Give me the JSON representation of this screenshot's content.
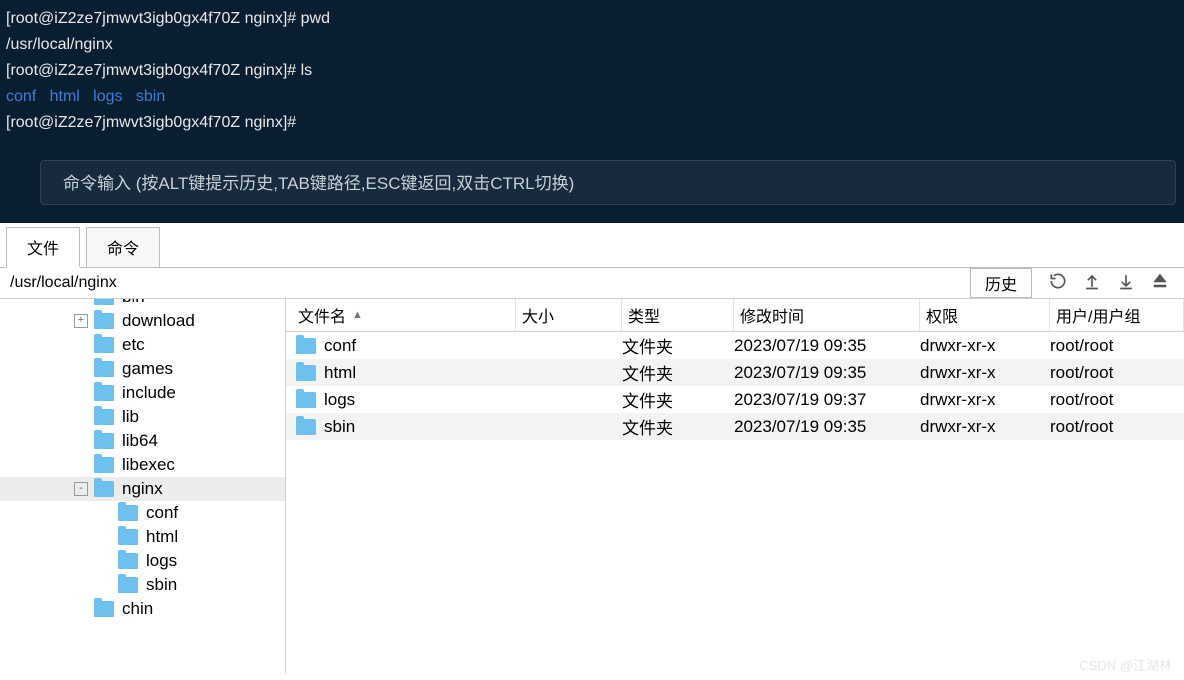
{
  "terminal": {
    "lines": [
      {
        "prompt": "[root@iZ2ze7jmwvt3igb0gx4f70Z nginx]# ",
        "cmd": "pwd"
      },
      {
        "plain": "/usr/local/nginx"
      },
      {
        "prompt": "[root@iZ2ze7jmwvt3igb0gx4f70Z nginx]# ",
        "cmd": "ls"
      },
      {
        "dirs": [
          "conf",
          "html",
          "logs",
          "sbin"
        ]
      },
      {
        "prompt": "[root@iZ2ze7jmwvt3igb0gx4f70Z nginx]# ",
        "cmd": ""
      }
    ],
    "hint": "命令输入 (按ALT键提示历史,TAB键路径,ESC键返回,双击CTRL切换)"
  },
  "tabs": {
    "file": "文件",
    "command": "命令"
  },
  "path": "/usr/local/nginx",
  "history_btn": "历史",
  "tree": {
    "items": [
      {
        "level": 1,
        "name": "bin",
        "cut": true
      },
      {
        "level": 1,
        "name": "download",
        "expander": "+"
      },
      {
        "level": 1,
        "name": "etc"
      },
      {
        "level": 1,
        "name": "games"
      },
      {
        "level": 1,
        "name": "include"
      },
      {
        "level": 1,
        "name": "lib"
      },
      {
        "level": 1,
        "name": "lib64"
      },
      {
        "level": 1,
        "name": "libexec"
      },
      {
        "level": 1,
        "name": "nginx",
        "expander": "-",
        "selected": true
      },
      {
        "level": 2,
        "name": "conf"
      },
      {
        "level": 2,
        "name": "html"
      },
      {
        "level": 2,
        "name": "logs"
      },
      {
        "level": 2,
        "name": "sbin"
      },
      {
        "level": 1,
        "name": "chin",
        "cutbottom": true
      }
    ]
  },
  "filelist": {
    "headers": {
      "name": "文件名",
      "size": "大小",
      "type": "类型",
      "date": "修改时间",
      "perm": "权限",
      "user": "用户/用户组"
    },
    "rows": [
      {
        "name": "conf",
        "type": "文件夹",
        "date": "2023/07/19 09:35",
        "perm": "drwxr-xr-x",
        "user": "root/root"
      },
      {
        "name": "html",
        "type": "文件夹",
        "date": "2023/07/19 09:35",
        "perm": "drwxr-xr-x",
        "user": "root/root"
      },
      {
        "name": "logs",
        "type": "文件夹",
        "date": "2023/07/19 09:37",
        "perm": "drwxr-xr-x",
        "user": "root/root"
      },
      {
        "name": "sbin",
        "type": "文件夹",
        "date": "2023/07/19 09:35",
        "perm": "drwxr-xr-x",
        "user": "root/root"
      }
    ]
  },
  "watermark": "CSDN @江湖林"
}
